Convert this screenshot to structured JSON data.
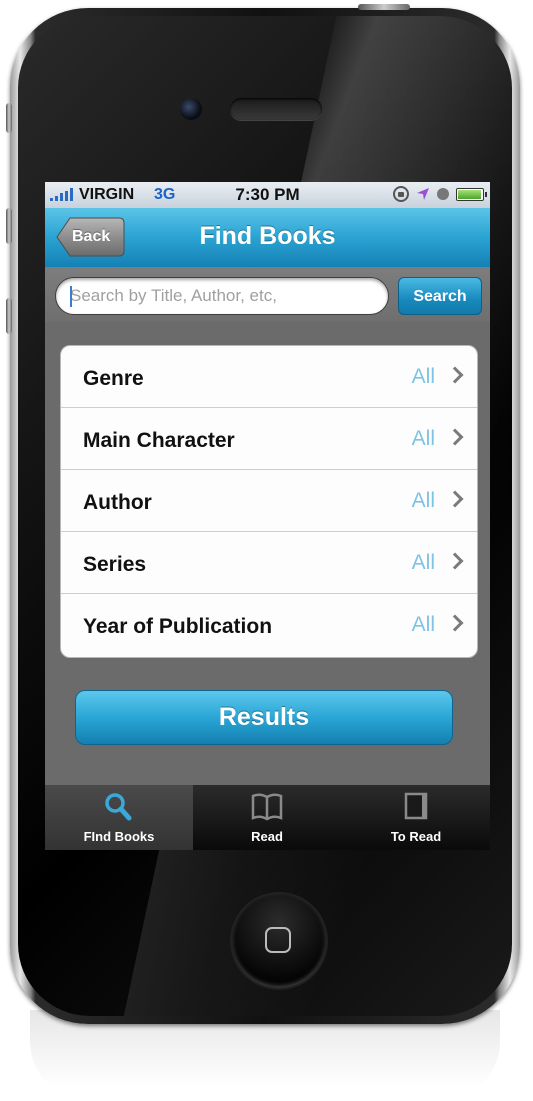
{
  "status_bar": {
    "carrier": "VIRGIN",
    "network": "3G",
    "time": "7:30 PM"
  },
  "nav": {
    "back_label": "Back",
    "title": "Find Books"
  },
  "search": {
    "placeholder": "Search by Title, Author, etc,",
    "button_label": "Search"
  },
  "filters": [
    {
      "label": "Genre",
      "value": "All"
    },
    {
      "label": "Main Character",
      "value": "All"
    },
    {
      "label": "Author",
      "value": "All"
    },
    {
      "label": "Series",
      "value": "All"
    },
    {
      "label": "Year of Publication",
      "value": "All"
    }
  ],
  "results_label": "Results",
  "tabs": [
    {
      "label": "FInd Books",
      "icon": "search-icon",
      "active": true
    },
    {
      "label": "Read",
      "icon": "open-book-icon",
      "active": false
    },
    {
      "label": "To Read",
      "icon": "closed-book-icon",
      "active": false
    }
  ],
  "colors": {
    "accent": "#2aa3d3",
    "value_text": "#7cc3e4"
  }
}
